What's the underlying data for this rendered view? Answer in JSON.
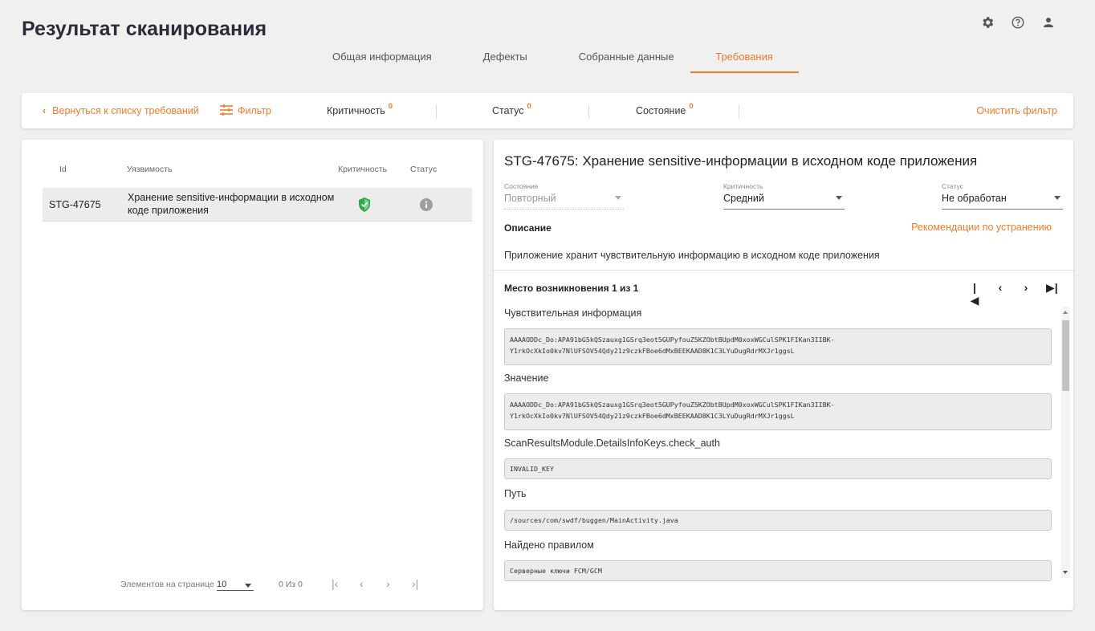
{
  "page": {
    "title": "Результат сканирования"
  },
  "top_icons": [
    "gear-icon",
    "help-icon",
    "user-icon"
  ],
  "tabs": [
    {
      "label": "Общая информация",
      "active": false
    },
    {
      "label": "Дефекты",
      "active": false
    },
    {
      "label": "Собранные данные",
      "active": false
    },
    {
      "label": "Требования",
      "active": true
    }
  ],
  "filter_bar": {
    "back_label": "Вернуться к списку требований",
    "filter_label": "Фильтр",
    "criticality": {
      "label": "Критичность",
      "count": "0"
    },
    "status": {
      "label": "Статус",
      "count": "0"
    },
    "state": {
      "label": "Состояние",
      "count": "0"
    },
    "clear_label": "Очистить фильтр"
  },
  "table": {
    "headers": {
      "id": "Id",
      "vuln": "Уязвимость",
      "crit": "Критичность",
      "status": "Статус"
    },
    "rows": [
      {
        "id": "STG-47675",
        "vuln_line1": "Хранение sensitive-информации в исходном",
        "vuln_line2": "коде приложения",
        "crit_icon": "shield-check-icon",
        "status_icon": "info-icon"
      }
    ]
  },
  "pagination": {
    "per_page_label": "Элементов на странице",
    "per_page_value": "10",
    "range": "0 Из 0"
  },
  "detail": {
    "title": "STG-47675: Хранение sensitive-информации в исходном коде приложения",
    "state": {
      "label": "Состояние",
      "value": "Повторный"
    },
    "criticality": {
      "label": "Критичность",
      "value": "Средний"
    },
    "status": {
      "label": "Статус",
      "value": "Не обработан"
    },
    "description_heading": "Описание",
    "recommendations_link": "Рекомендации по устранению",
    "description_text": "Приложение хранит чувствительную информацию в исходном коде приложения",
    "occurrence_heading": "Место возникновения 1 из 1",
    "items": [
      {
        "label": "Чувствительная информация",
        "line1": "AAAAODDc_Do:APA91bG5kQSzauxg1GSrq3eot5GUPyfouZ5KZObtBUpdM0xoxWGCulSPK1FIKan3IIBK-",
        "line2": "Y1rkOcXkIo0kv7NlUFSOV54Qdy21z9czkFBoe6dMxBEEKAAD8K1C3LYuDugRdrMXJr1ggsL"
      },
      {
        "label": "Значение",
        "line1": "AAAAODDc_Do:APA91bG5kQSzauxg1GSrq3eot5GUPyfouZ5KZObtBUpdM0xoxWGCulSPK1FIKan3IIBK-",
        "line2": "Y1rkOcXkIo0kv7NlUFSOV54Qdy21z9czkFBoe6dMxBEEKAAD8K1C3LYuDugRdrMXJr1ggsL"
      },
      {
        "label": "ScanResultsModule.DetailsInfoKeys.check_auth",
        "line1": "INVALID_KEY"
      },
      {
        "label": "Путь",
        "line1": "/sources/com/swdf/buggen/MainActivity.java"
      },
      {
        "label": "Найдено правилом",
        "line1": "Серверные ключи FCM/GCM"
      }
    ]
  },
  "colors": {
    "accent": "#f07c2a",
    "shield": "#2ea84f",
    "info": "#9e9e9e"
  }
}
